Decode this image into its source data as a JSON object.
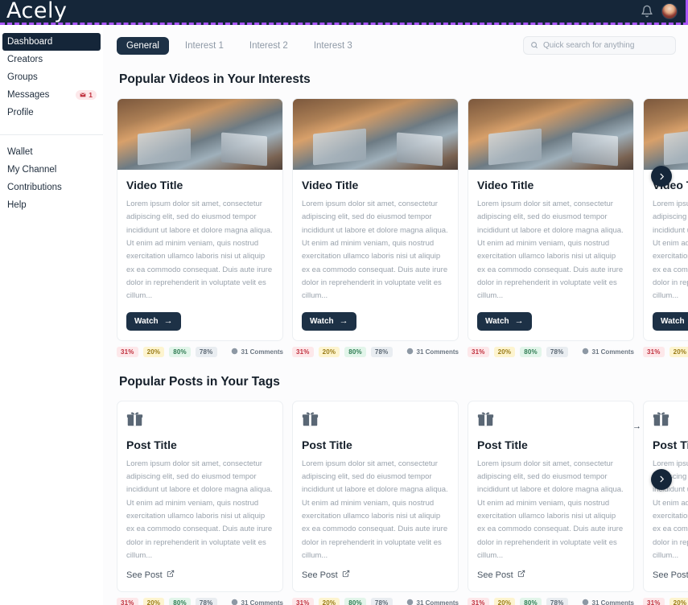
{
  "header": {
    "logo": "Acely",
    "bell_icon": "bell-icon",
    "avatar_icon": "user-avatar",
    "accent_color": "#a855f7",
    "background_color": "#152639"
  },
  "sidebar": {
    "group_one": [
      {
        "label": "Dashboard",
        "active": true
      },
      {
        "label": "Creators",
        "active": false
      },
      {
        "label": "Groups",
        "active": false
      },
      {
        "label": "Messages",
        "active": false,
        "badge": "1",
        "badge_icon": "envelope-icon"
      },
      {
        "label": "Profile",
        "active": false
      }
    ],
    "group_two": [
      {
        "label": "Wallet"
      },
      {
        "label": "My Channel"
      },
      {
        "label": "Contributions"
      },
      {
        "label": "Help"
      }
    ]
  },
  "topbar": {
    "tabs": [
      {
        "label": "General",
        "active": true
      },
      {
        "label": "Interest 1",
        "active": false
      },
      {
        "label": "Interest 2",
        "active": false
      },
      {
        "label": "Interest 3",
        "active": false
      }
    ],
    "search": {
      "placeholder": "Quick search for anything",
      "value": "",
      "icon": "search-icon"
    }
  },
  "sections": {
    "videos": {
      "title": "Popular Videos in Your Interests",
      "card_title": "Video Title",
      "card_text": "Lorem ipsum dolor sit amet, consectetur adipiscing elit, sed do eiusmod tempor incididunt ut labore et dolore magna aliqua. Ut enim ad minim veniam, quis nostrud exercitation ullamco laboris nisi ut aliquip ex ea commodo consequat. Duis aute irure dolor in reprehenderit in voluptate velit es cillum...",
      "button_label": "Watch",
      "button_arrow": "→",
      "next_label": "›"
    },
    "posts": {
      "title": "Popular Posts in Your Tags",
      "card_title": "Post Title",
      "card_text": "Lorem ipsum dolor sit amet, consectetur adipiscing elit, sed do eiusmod tempor incididunt ut labore et dolore magna aliqua. Ut enim ad minim veniam, quis nostrud exercitation ullamco laboris nisi ut aliquip ex ea commodo consequat. Duis aute irure dolor in reprehenderit in voluptate velit es cillum...",
      "link_label": "See Post",
      "link_icon": "external-link-icon",
      "card_icon": "gift-icon",
      "next_label": "›",
      "prev_label": "→"
    }
  },
  "stats": {
    "badges": [
      {
        "value": "31%",
        "bg": "#fde8ea",
        "fg": "#c0323f"
      },
      {
        "value": "20%",
        "bg": "#fdf4cf",
        "fg": "#9a7b16"
      },
      {
        "value": "80%",
        "bg": "#e2f5ea",
        "fg": "#2f7d53"
      },
      {
        "value": "78%",
        "bg": "#e9edf1",
        "fg": "#5c6874"
      }
    ],
    "comments_label": "31 Comments",
    "comments_icon": "comment-icon"
  }
}
